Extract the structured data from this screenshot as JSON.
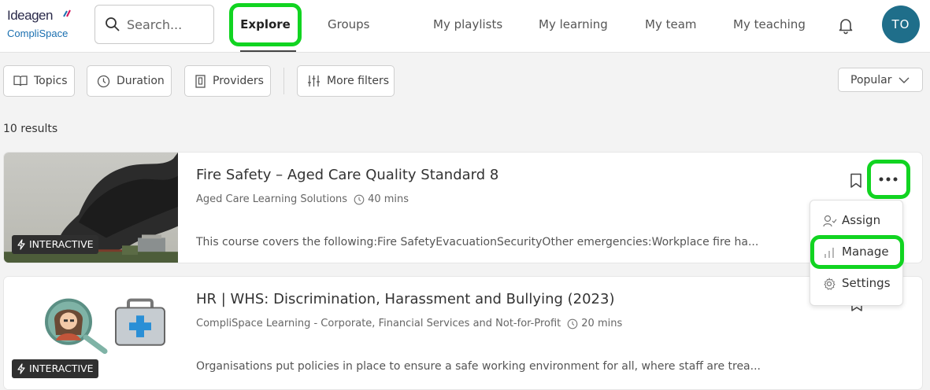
{
  "logo": {
    "line1": "Ideagen",
    "line2": "CompliSpace"
  },
  "search": {
    "placeholder": "Search..."
  },
  "nav": {
    "explore": "Explore",
    "groups": "Groups",
    "playlists": "My playlists",
    "learning": "My learning",
    "team": "My team",
    "teaching": "My teaching"
  },
  "user": {
    "initials": "TO"
  },
  "filters": {
    "topics": "Topics",
    "duration": "Duration",
    "providers": "Providers",
    "more": "More filters",
    "sort": "Popular"
  },
  "results": "10 results",
  "cards": [
    {
      "badge": "INTERACTIVE",
      "title": "Fire Safety – Aged Care Quality Standard 8",
      "provider": "Aged Care Learning Solutions",
      "duration": "40 mins",
      "description": "This course covers the following:Fire SafetyEvacuationSecurityOther emergencies:Workplace fire ha..."
    },
    {
      "badge": "INTERACTIVE",
      "title": "HR | WHS: Discrimination, Harassment and Bullying (2023)",
      "provider": "CompliSpace Learning - Corporate, Financial Services and Not-for-Profit",
      "duration": "20 mins",
      "description": "Organisations put policies in place to ensure a safe working environment for all, where staff are trea..."
    }
  ],
  "menu": {
    "assign": "Assign",
    "manage": "Manage",
    "settings": "Settings"
  },
  "colors": {
    "highlight": "#11d421",
    "avatar": "#1f6e8a"
  }
}
